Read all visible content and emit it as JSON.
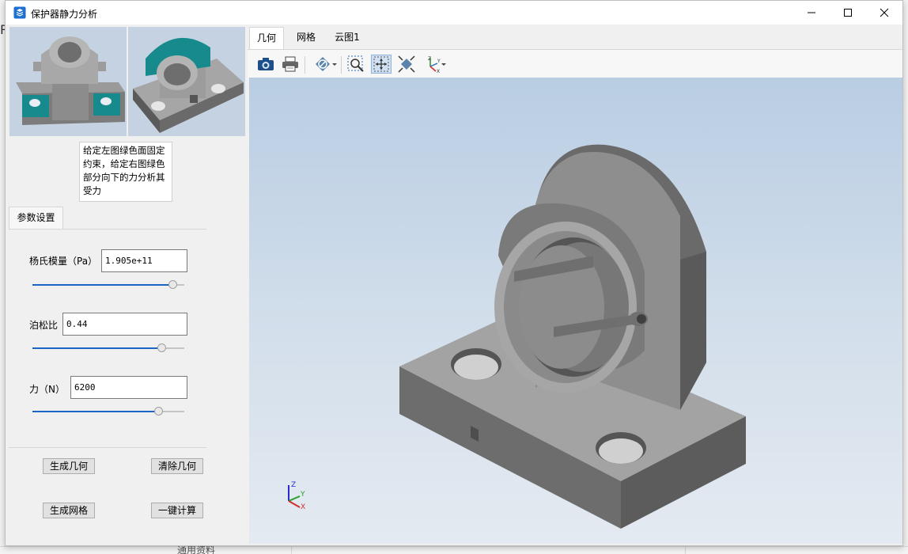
{
  "background": {
    "left_fragment": "R",
    "bottom_text": "通用资料"
  },
  "window": {
    "title": "保护器静力分析",
    "icons": {
      "app": "app-icon",
      "minimize": "minimize-icon",
      "maximize": "maximize-icon",
      "close": "close-icon"
    }
  },
  "left": {
    "hint": "给定左图绿色面固定约束，给定右图绿色部分向下的力分析其受力",
    "param_tab": "参数设置",
    "params": [
      {
        "label": "杨氏模量（Pa）",
        "value": "1.905e+11",
        "slider": 0.92
      },
      {
        "label": "泊松比",
        "value": "0.44",
        "slider": 0.85
      },
      {
        "label": "力（N）",
        "value": "6200",
        "slider": 0.83
      }
    ],
    "buttons": {
      "gen_geometry": "生成几何",
      "clear_geometry": "清除几何",
      "gen_mesh": "生成网格",
      "compute": "一键计算"
    }
  },
  "right": {
    "tabs": [
      "几何",
      "网格",
      "云图1"
    ],
    "active_tab": 0,
    "toolbar_icons": [
      "camera-icon",
      "printer-icon",
      "display-mode-icon",
      "zoom-box-icon",
      "fit-all-icon",
      "zoom-extents-icon",
      "axis-view-icon"
    ]
  },
  "axis_labels": {
    "z": "Z",
    "y": "Y",
    "x": "X"
  },
  "colors": {
    "accent_teal": "#168a8c",
    "slider_blue": "#1a66c4",
    "model_gray": "#8a8a8a"
  }
}
